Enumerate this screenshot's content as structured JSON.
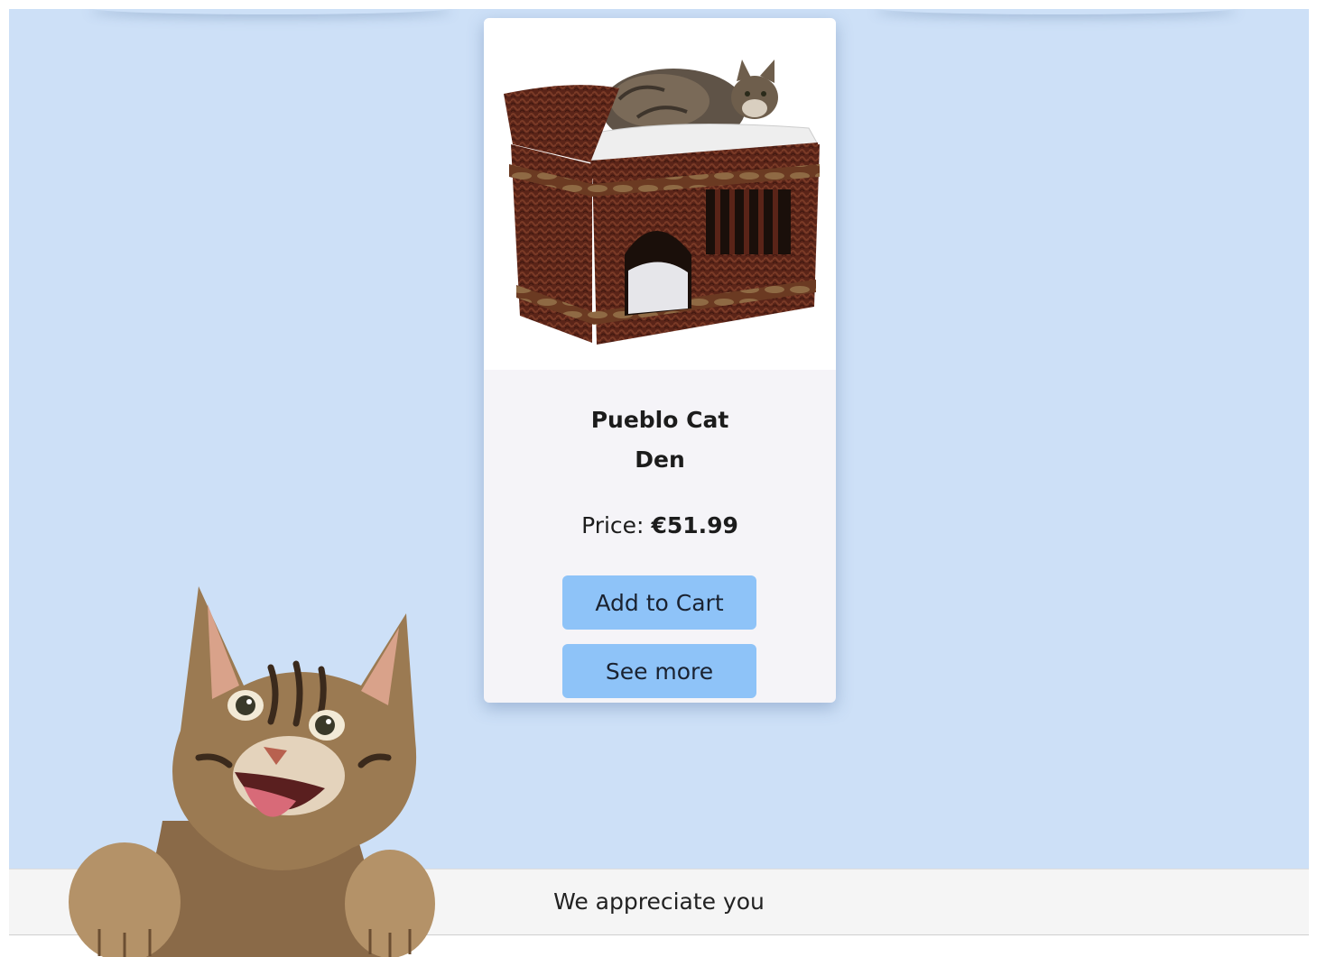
{
  "product": {
    "title_line1": "Pueblo Cat",
    "title_line2": "Den",
    "price_label": "Price:",
    "price_value": "€51.99",
    "add_to_cart_label": "Add to Cart",
    "see_more_label": "See more"
  },
  "footer": {
    "message": "We appreciate you"
  },
  "colors": {
    "page_background": "#cde0f7",
    "card_body": "#f5f4f8",
    "button": "#8ec3f8",
    "footer": "#f5f5f5"
  },
  "icons": {
    "product_image": "wicker-cat-den-photo",
    "mascot": "happy-tabby-cat-photo"
  }
}
